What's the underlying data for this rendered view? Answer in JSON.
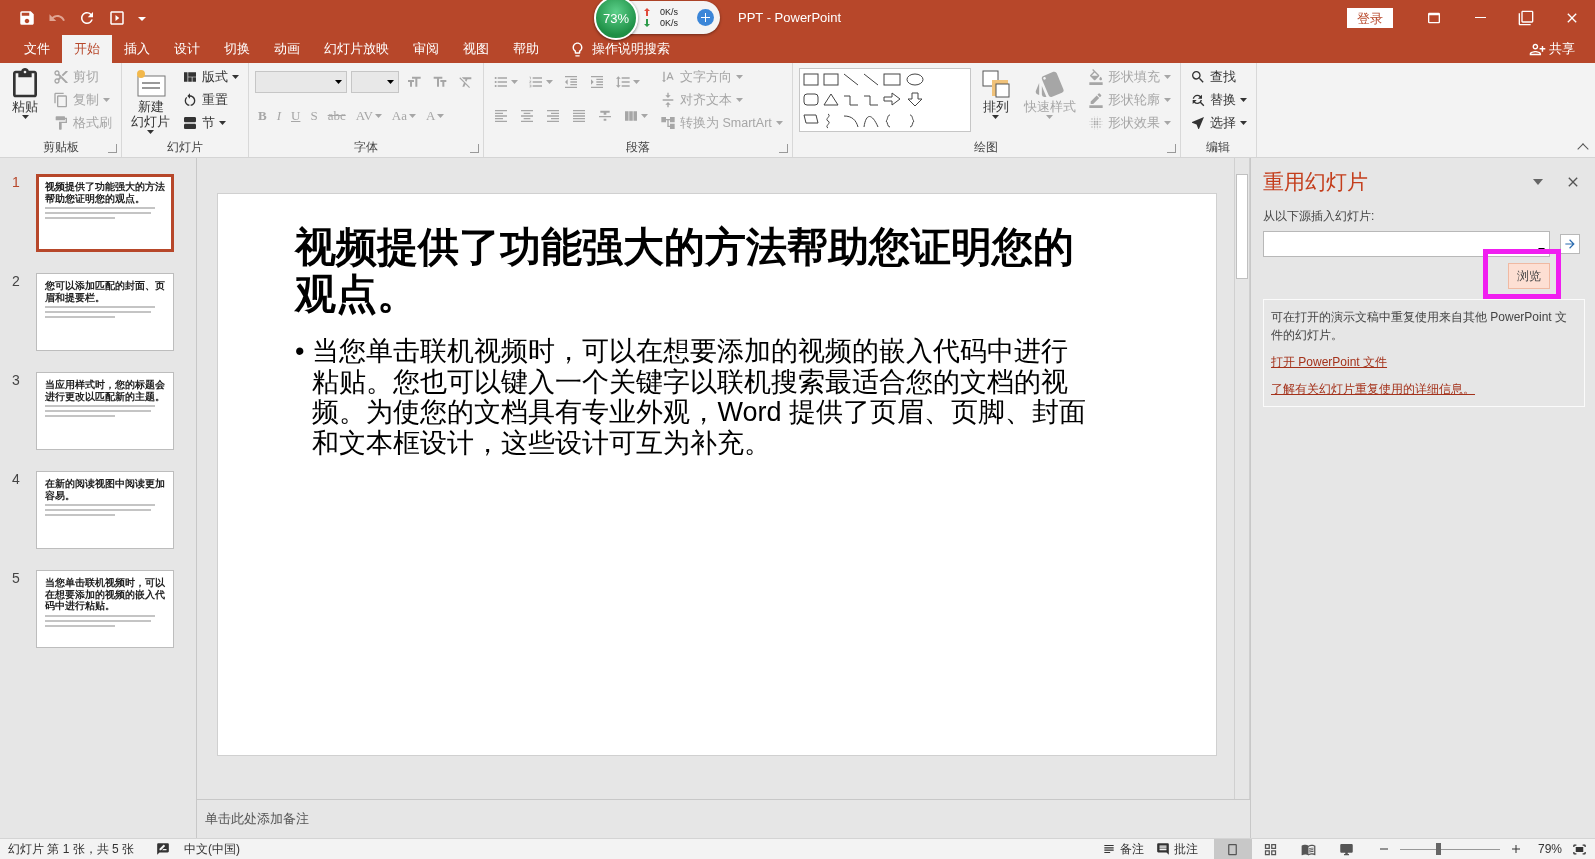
{
  "title_bar": {
    "title": "PPT  -  PowerPoint",
    "sign_in": "登录",
    "quick_access": [
      {
        "kind": "save",
        "disabled": false
      },
      {
        "kind": "undo",
        "disabled": true
      },
      {
        "kind": "repeat",
        "disabled": false
      },
      {
        "kind": "start-show",
        "disabled": false
      },
      {
        "kind": "customize",
        "disabled": false
      }
    ],
    "window_buttons": [
      {
        "kind": "ribbon-options"
      },
      {
        "kind": "minimize"
      },
      {
        "kind": "restore"
      },
      {
        "kind": "close"
      }
    ]
  },
  "speed_widget": {
    "percent": "73%",
    "upload": "0K/s",
    "download": "0K/s"
  },
  "tabs": [
    {
      "label": "文件",
      "selected": false
    },
    {
      "label": "开始",
      "selected": true
    },
    {
      "label": "插入",
      "selected": false
    },
    {
      "label": "设计",
      "selected": false
    },
    {
      "label": "切换",
      "selected": false
    },
    {
      "label": "动画",
      "selected": false
    },
    {
      "label": "幻灯片放映",
      "selected": false
    },
    {
      "label": "审阅",
      "selected": false
    },
    {
      "label": "视图",
      "selected": false
    },
    {
      "label": "帮助",
      "selected": false
    }
  ],
  "tell_me": "操作说明搜索",
  "share": "共享",
  "ribbon": {
    "groups": [
      {
        "title": "剪贴板",
        "launcher": true,
        "sections": [
          {
            "kind": "large",
            "items": [
              {
                "kind": "paste",
                "label": "粘贴",
                "disabled": false,
                "caret": true
              }
            ]
          },
          {
            "kind": "stack",
            "items": [
              {
                "kind": "cut",
                "label": "剪切",
                "disabled": true,
                "caret": false
              },
              {
                "kind": "copy",
                "label": "复制",
                "disabled": true,
                "caret": true
              },
              {
                "kind": "format-painter",
                "label": "格式刷",
                "disabled": true,
                "caret": false
              }
            ]
          }
        ]
      },
      {
        "title": "幻灯片",
        "launcher": false,
        "sections": [
          {
            "kind": "large",
            "items": [
              {
                "kind": "new-slide",
                "label_lines": [
                  "新建",
                  "幻灯片"
                ],
                "disabled": false,
                "caret": true
              }
            ]
          },
          {
            "kind": "stack",
            "items": [
              {
                "kind": "layout",
                "label": "版式",
                "disabled": false,
                "caret": true
              },
              {
                "kind": "reset",
                "label": "重置",
                "disabled": false,
                "caret": false
              },
              {
                "kind": "section",
                "label": "节",
                "disabled": false,
                "caret": true
              }
            ]
          }
        ]
      },
      {
        "title": "字体",
        "launcher": true,
        "sections": [
          {
            "kind": "rows",
            "rows": [
              [
                {
                  "kind": "font-name-field",
                  "disabled": true
                },
                {
                  "kind": "font-size-field",
                  "disabled": true
                },
                {
                  "kind": "grow-font",
                  "disabled": true,
                  "caret": false
                },
                {
                  "kind": "shrink-font",
                  "disabled": true,
                  "caret": false
                },
                {
                  "kind": "clear-format",
                  "disabled": true,
                  "caret": false
                }
              ],
              [
                {
                  "kind": "bold",
                  "label": "B",
                  "disabled": true,
                  "caret": false
                },
                {
                  "kind": "italic",
                  "label": "I",
                  "disabled": true,
                  "caret": false
                },
                {
                  "kind": "underline",
                  "label": "U",
                  "disabled": true,
                  "caret": false
                },
                {
                  "kind": "shadow",
                  "label": "S",
                  "disabled": true,
                  "caret": false
                },
                {
                  "kind": "strikethrough",
                  "label": "abc",
                  "disabled": true,
                  "caret": false
                },
                {
                  "kind": "spacing",
                  "label": "AV",
                  "disabled": true,
                  "caret": true
                },
                {
                  "kind": "case",
                  "label": "Aa",
                  "disabled": true,
                  "caret": true
                },
                {
                  "kind": "font-color",
                  "label": "A",
                  "disabled": true,
                  "caret": true
                }
              ]
            ]
          }
        ]
      },
      {
        "title": "段落",
        "launcher": true,
        "sections": [
          {
            "kind": "rows",
            "rows": [
              [
                {
                  "kind": "bullets",
                  "disabled": true,
                  "caret": true
                },
                {
                  "kind": "numbering",
                  "disabled": true,
                  "caret": true
                },
                {
                  "kind": "indent-decrease",
                  "disabled": true,
                  "caret": false
                },
                {
                  "kind": "indent-increase",
                  "disabled": true,
                  "caret": false
                },
                {
                  "kind": "line-spacing",
                  "disabled": true,
                  "caret": true
                }
              ],
              [
                {
                  "kind": "align-left",
                  "disabled": true,
                  "caret": false
                },
                {
                  "kind": "align-center",
                  "disabled": true,
                  "caret": false
                },
                {
                  "kind": "align-right",
                  "disabled": true,
                  "caret": false
                },
                {
                  "kind": "justify",
                  "disabled": true,
                  "caret": false
                },
                {
                  "kind": "distribute",
                  "disabled": true,
                  "caret": false
                },
                {
                  "kind": "columns",
                  "disabled": true,
                  "caret": true
                }
              ]
            ]
          },
          {
            "kind": "stack",
            "items": [
              {
                "kind": "text-direction",
                "label": "文字方向",
                "disabled": true,
                "caret": true
              },
              {
                "kind": "align-text",
                "label": "对齐文本",
                "disabled": true,
                "caret": true
              },
              {
                "kind": "smartart",
                "label": "转换为 SmartArt",
                "disabled": true,
                "caret": true
              }
            ]
          }
        ]
      },
      {
        "title": "绘图",
        "launcher": true,
        "sections": [
          {
            "kind": "gallery"
          },
          {
            "kind": "large",
            "items": [
              {
                "kind": "arrange",
                "label": "排列",
                "disabled": false,
                "caret": true
              },
              {
                "kind": "quick-styles",
                "label": "快速样式",
                "disabled": true,
                "caret": true
              }
            ]
          },
          {
            "kind": "stack",
            "items": [
              {
                "kind": "shape-fill",
                "label": "形状填充",
                "disabled": true,
                "caret": true
              },
              {
                "kind": "shape-outline",
                "label": "形状轮廓",
                "disabled": true,
                "caret": true
              },
              {
                "kind": "shape-effects",
                "label": "形状效果",
                "disabled": true,
                "caret": true
              }
            ]
          }
        ]
      },
      {
        "title": "编辑",
        "launcher": false,
        "sections": [
          {
            "kind": "stack",
            "items": [
              {
                "kind": "find",
                "label": "查找",
                "disabled": false,
                "caret": false
              },
              {
                "kind": "replace",
                "label": "替换",
                "disabled": false,
                "caret": true
              },
              {
                "kind": "select",
                "label": "选择",
                "disabled": false,
                "caret": true
              }
            ]
          }
        ]
      }
    ]
  },
  "slides": [
    {
      "number": "1",
      "title": "视频提供了功能强大的方法帮助您证明您的观点。",
      "selected": true
    },
    {
      "number": "2",
      "title": "您可以添加匹配的封面、页眉和提要栏。",
      "selected": false
    },
    {
      "number": "3",
      "title": "当应用样式时，您的标题会进行更改以匹配新的主题。",
      "selected": false
    },
    {
      "number": "4",
      "title": "在新的阅读视图中阅读更加容易。",
      "selected": false
    },
    {
      "number": "5",
      "title": "当您单击联机视频时，可以在想要添加的视频的嵌入代码中进行粘贴。",
      "selected": false
    }
  ],
  "slide": {
    "title": "视频提供了功能强大的方法帮助您证明您的观点。",
    "bullet": "•",
    "bullets": [
      "当您单击联机视频时，可以在想要添加的视频的嵌入代码中进行粘贴。您也可以键入一个关键字以联机搜索最适合您的文档的视频。为使您的文档具有专业外观，Word 提供了页眉、页脚、封面和文本框设计，这些设计可互为补充。"
    ]
  },
  "notes": {
    "placeholder": "单击此处添加备注"
  },
  "reuse_pane": {
    "title": "重用幻灯片",
    "source_label": "从以下源插入幻灯片:",
    "browse": "浏览",
    "browse_highlighted": true,
    "info": "可在打开的演示文稿中重复使用来自其他 PowerPoint 文件的幻灯片。",
    "links": [
      "打开 PowerPoint 文件",
      "了解有关幻灯片重复使用的详细信息。"
    ]
  },
  "status_bar": {
    "slide_info": "幻灯片 第 1 张，共 5 张",
    "language": "中文(中国)",
    "notes": "备注",
    "comments": "批注",
    "views": [
      {
        "kind": "normal",
        "selected": true
      },
      {
        "kind": "sorter",
        "selected": false
      },
      {
        "kind": "reading",
        "selected": false
      },
      {
        "kind": "slideshow",
        "selected": false
      }
    ],
    "zoom": {
      "level": 0.38,
      "reading": "79%"
    }
  }
}
